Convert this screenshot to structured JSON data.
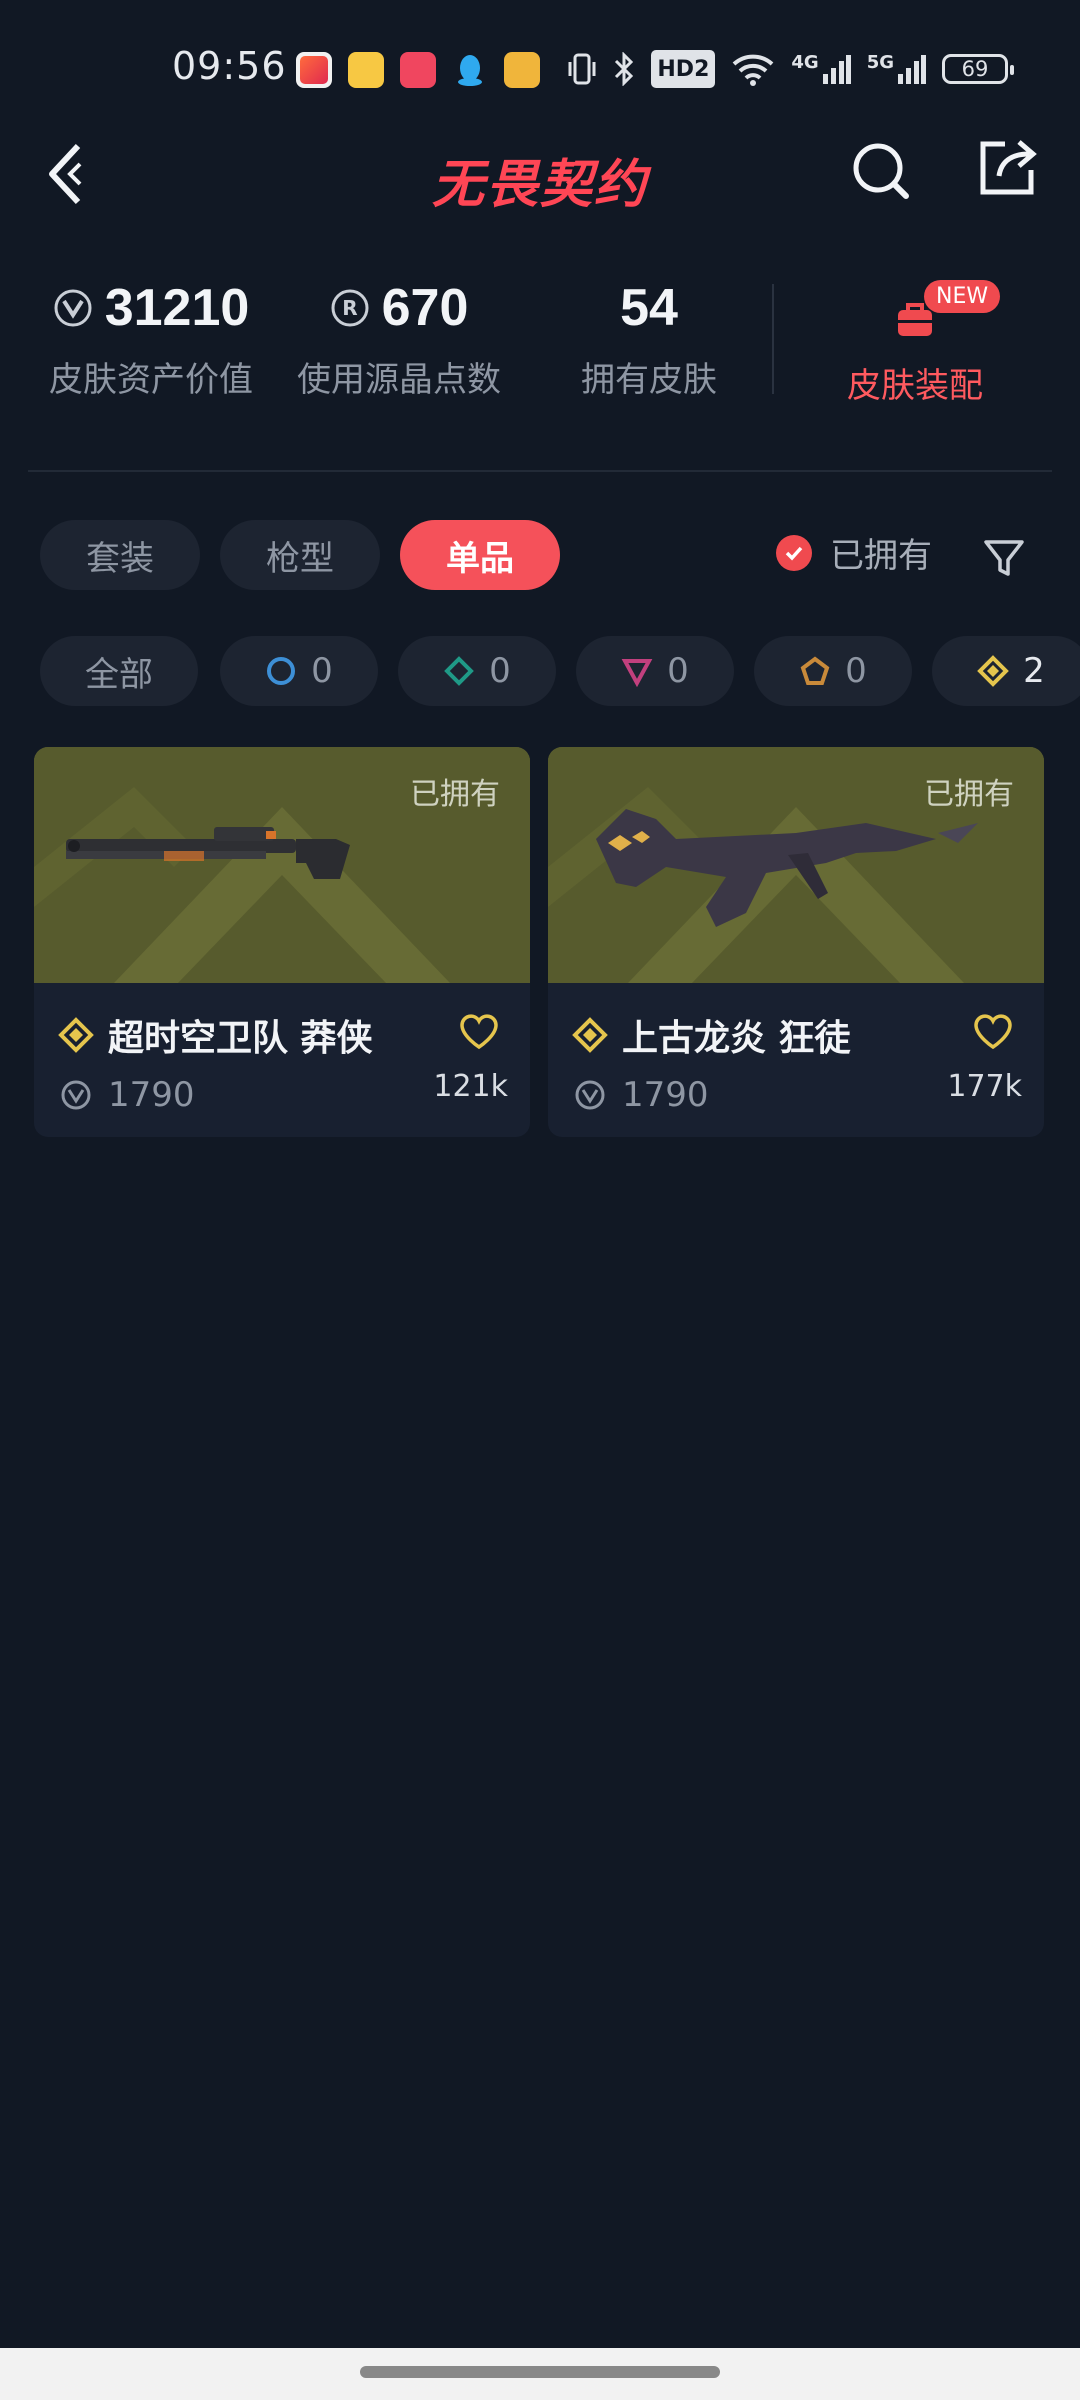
{
  "status_bar": {
    "time": "09:56",
    "battery": "69",
    "network": [
      "4G",
      "5G"
    ],
    "hd_label": "HD2"
  },
  "header": {
    "title": "无畏契约",
    "back_icon": "chevron-left-icon",
    "search_icon": "search-icon",
    "share_icon": "share-icon"
  },
  "stats": {
    "asset_value": "31210",
    "asset_label": "皮肤资产价值",
    "points": "670",
    "points_label": "使用源晶点数",
    "owned_count": "54",
    "owned_label": "拥有皮肤",
    "loadout_label": "皮肤装配",
    "new_badge": "NEW"
  },
  "tabs": [
    {
      "label": "套装",
      "active": false
    },
    {
      "label": "枪型",
      "active": false
    },
    {
      "label": "单品",
      "active": true
    }
  ],
  "owned_filter": {
    "label": "已拥有",
    "checked": true
  },
  "rarity_chips": [
    {
      "label": "全部",
      "count": ""
    },
    {
      "icon": "select-tier-icon",
      "color": "#3d8fd6",
      "count": "0"
    },
    {
      "icon": "deluxe-tier-icon",
      "color": "#1f9a87",
      "count": "0"
    },
    {
      "icon": "premium-tier-icon",
      "color": "#c2407e",
      "count": "0"
    },
    {
      "icon": "ultra-tier-icon",
      "color": "#c98a3a",
      "count": "0"
    },
    {
      "icon": "exclusive-tier-icon",
      "color": "#e5c54d",
      "count": "2"
    }
  ],
  "cards": [
    {
      "owned": "已拥有",
      "name": "超时空卫队 莽侠",
      "price": "1790",
      "likes": "121k"
    },
    {
      "owned": "已拥有",
      "name": "上古龙炎 狂徒",
      "price": "1790",
      "likes": "177k"
    }
  ],
  "colors": {
    "background": "#111824",
    "accent": "#f5515a",
    "tier_gold": "#e5c54d"
  }
}
